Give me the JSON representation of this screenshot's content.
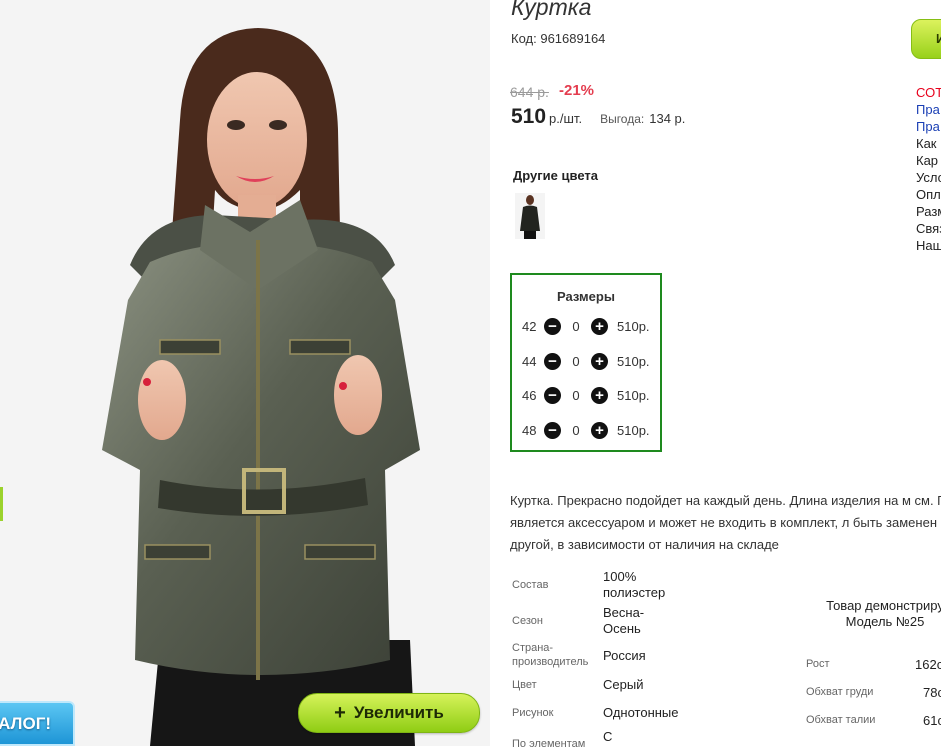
{
  "product": {
    "title": "Куртка",
    "code_label": "Код:",
    "code": "961689164",
    "old_price": "644 р.",
    "discount": "-21%",
    "price": "510",
    "price_unit": "р./шт.",
    "benefit_label": "Выгода:",
    "benefit_value": "134 р."
  },
  "colors": {
    "title": "Другие цвета",
    "thumbnail_icon": "jacket-thumbnail"
  },
  "sizes": {
    "title": "Размеры",
    "rows": [
      {
        "size": "42",
        "qty": "0",
        "price": "510р."
      },
      {
        "size": "44",
        "qty": "0",
        "price": "510р."
      },
      {
        "size": "46",
        "qty": "0",
        "price": "510р."
      },
      {
        "size": "48",
        "qty": "0",
        "price": "510р."
      }
    ],
    "minus_glyph": "−",
    "plus_glyph": "+"
  },
  "description": "Куртка. Прекрасно подойдет на каждый день. Длина изделия на м см. Пояс является аксессуаром и может не входить в комплект, л быть заменен на другой, в зависимости от наличия на складе",
  "properties": [
    {
      "label": "Состав",
      "value": "100% полиэстер"
    },
    {
      "label": "Сезон",
      "value": "Весна-Осень"
    },
    {
      "label": "Страна-производитель",
      "value": "Россия"
    },
    {
      "label": "Цвет",
      "value": "Серый"
    },
    {
      "label": "Рисунок",
      "value": "Однотонные"
    },
    {
      "label": "По элементам",
      "value": "С"
    }
  ],
  "model": {
    "line1": "Товар демонстриру",
    "line2": "Модель №25",
    "rows": [
      {
        "label": "Рост",
        "value": "162с"
      },
      {
        "label": "Обхват груди",
        "value": "78с"
      },
      {
        "label": "Обхват талии",
        "value": "61с"
      }
    ]
  },
  "gallery": {
    "zoom_label": "Увеличить",
    "zoom_icon": "+",
    "catalog_badge": "ТАЛОГ!"
  },
  "right_panel": {
    "button_label": "И",
    "links": [
      {
        "text": "СОТ",
        "style": "red"
      },
      {
        "text": "Пра",
        "style": "blue"
      },
      {
        "text": "Пра",
        "style": "blue"
      },
      {
        "text": "Как",
        "style": "dark"
      },
      {
        "text": "Кар",
        "style": "dark"
      },
      {
        "text": "Усло",
        "style": "dark"
      },
      {
        "text": "Опл",
        "style": "dark"
      },
      {
        "text": "Разм",
        "style": "dark"
      },
      {
        "text": "Связ",
        "style": "dark"
      },
      {
        "text": "Наш",
        "style": "dark"
      }
    ]
  },
  "colors_theme": {
    "discount": "#e43d4f",
    "sizes_border": "#1e8a1e",
    "zoom_button": "#9bd22c",
    "catalog_badge": "#1e95d6",
    "link_red": "#e8001c",
    "link_blue": "#1a3fb5"
  }
}
